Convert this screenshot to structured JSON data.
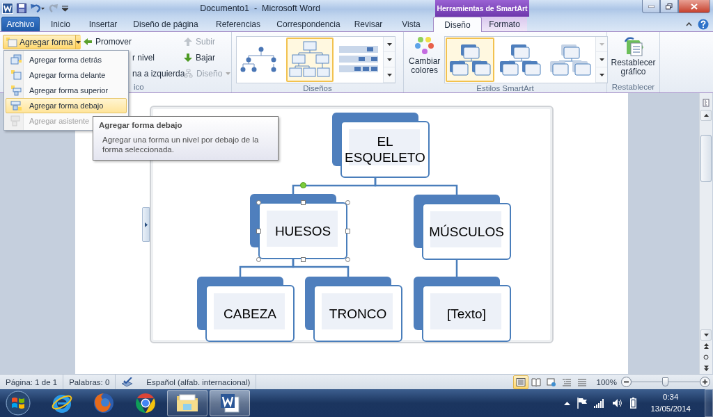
{
  "window": {
    "title": "Documento1  -  Microsoft Word",
    "contextual_header": "Herramientas de SmartArt"
  },
  "quick_access": [
    {
      "kind": "save",
      "disabled": false
    },
    {
      "kind": "undo",
      "disabled": false
    },
    {
      "kind": "redo",
      "disabled": true
    }
  ],
  "tabs": [
    {
      "label": "Archivo",
      "kind": "file",
      "selected": false
    },
    {
      "label": "Inicio",
      "kind": "normal",
      "selected": false
    },
    {
      "label": "Insertar",
      "kind": "normal",
      "selected": false
    },
    {
      "label": "Diseño de página",
      "kind": "normal",
      "selected": false
    },
    {
      "label": "Referencias",
      "kind": "normal",
      "selected": false
    },
    {
      "label": "Correspondencia",
      "kind": "normal",
      "selected": false
    },
    {
      "label": "Revisar",
      "kind": "normal",
      "selected": false
    },
    {
      "label": "Vista",
      "kind": "normal",
      "selected": false
    },
    {
      "label": "Diseño",
      "kind": "contextual",
      "selected": true
    },
    {
      "label": "Formato",
      "kind": "contextual",
      "selected": false
    }
  ],
  "ribbon": {
    "graphic_group": {
      "label": "ico",
      "add_shape": {
        "label": "Agregar forma",
        "open": true
      },
      "commands": [
        {
          "label": "Promover",
          "kind": "promote",
          "disabled": false
        },
        {
          "label": "r nivel",
          "kind": "clipped",
          "disabled": false
        },
        {
          "label": "na a izquierda",
          "kind": "clipped",
          "disabled": false
        },
        {
          "label": "Subir",
          "kind": "up",
          "disabled": true
        },
        {
          "label": "Bajar",
          "kind": "down",
          "disabled": false
        },
        {
          "label": "Diseño",
          "kind": "layout",
          "disabled": true
        }
      ]
    },
    "layouts": {
      "label": "Diseños",
      "items": [
        {
          "kind": "dots",
          "selected": false
        },
        {
          "kind": "boxes",
          "selected": true
        },
        {
          "kind": "table",
          "selected": false
        }
      ]
    },
    "styles": {
      "label": "Estilos SmartArt",
      "change_colors": "Cambiar colores",
      "items": [
        {
          "kind": "flat",
          "selected": true
        },
        {
          "kind": "shadow",
          "selected": false
        },
        {
          "kind": "stacked",
          "selected": false
        }
      ]
    },
    "reset": {
      "label": "Restablecer",
      "button": "Restablecer gráfico"
    }
  },
  "add_shape_menu": [
    {
      "label": "Agregar forma detrás",
      "selected": false,
      "disabled": false
    },
    {
      "label": "Agregar forma delante",
      "selected": false,
      "disabled": false
    },
    {
      "label": "Agregar forma superior",
      "selected": false,
      "disabled": false
    },
    {
      "label": "Agregar forma debajo",
      "selected": true,
      "disabled": false
    },
    {
      "label": "Agregar asistente",
      "selected": false,
      "disabled": true
    }
  ],
  "tooltip": {
    "title": "Agregar forma debajo",
    "text": "Agregar una forma un nivel por debajo de la forma seleccionada."
  },
  "diagram": {
    "root": {
      "text": "EL ESQUELETO",
      "selected": false,
      "children": [
        {
          "text": "HUESOS",
          "selected": true,
          "children": [
            {
              "text": "CABEZA",
              "selected": false
            },
            {
              "text": "TRONCO",
              "selected": false
            }
          ]
        },
        {
          "text": "MÚSCULOS",
          "selected": false,
          "children": [
            {
              "text": "[Texto]",
              "selected": false
            }
          ]
        }
      ]
    }
  },
  "status_bar": {
    "page": "Página: 1 de 1",
    "words": "Palabras: 0",
    "language": "Español (alfab. internacional)",
    "views": [
      {
        "kind": "print",
        "selected": true
      },
      {
        "kind": "reading",
        "selected": false
      },
      {
        "kind": "web",
        "selected": false
      },
      {
        "kind": "outline",
        "selected": false
      },
      {
        "kind": "draft",
        "selected": false
      }
    ],
    "zoom": "100%",
    "zoom_slider": {
      "level": 0.5
    }
  },
  "taskbar": {
    "apps": [
      {
        "kind": "ie",
        "running": false,
        "selected": false
      },
      {
        "kind": "firefox",
        "running": false,
        "selected": false
      },
      {
        "kind": "chrome",
        "running": false,
        "selected": false
      },
      {
        "kind": "explorer",
        "running": true,
        "selected": false
      },
      {
        "kind": "word",
        "running": true,
        "selected": true
      }
    ],
    "clock": {
      "time": "0:34",
      "date": "13/05/2014"
    }
  }
}
